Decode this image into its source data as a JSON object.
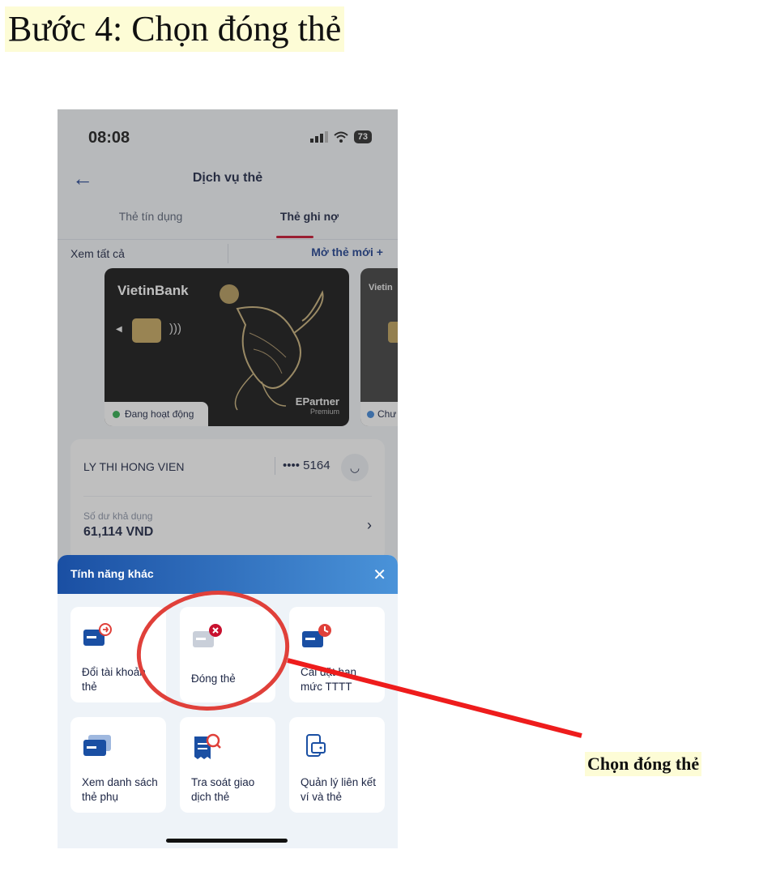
{
  "doc": {
    "title": "Bước 4: Chọn đóng thẻ",
    "note": "Chọn đóng thẻ"
  },
  "status_bar": {
    "time": "08:08",
    "battery": "73"
  },
  "header": {
    "title": "Dịch vụ thẻ"
  },
  "tabs": [
    {
      "label": "Thẻ tín dụng",
      "active": false
    },
    {
      "label": "Thẻ ghi nợ",
      "active": true
    }
  ],
  "filter": {
    "view_all": "Xem tất cả",
    "open_new": "Mở thẻ mới +"
  },
  "card": {
    "bank": "VietinBank",
    "status": "Đang hoạt động",
    "brand": "EPartner",
    "tier": "Premium"
  },
  "card2": {
    "bank": "Vietin",
    "status": "Chư"
  },
  "account": {
    "holder": "LY THI HONG VIEN",
    "masked_number": "•••• 5164",
    "balance_label": "Số dư khả dụng",
    "balance_value": "61,114 VND"
  },
  "sheet": {
    "title": "Tính năng khác",
    "tiles": [
      {
        "label": "Đổi tài khoản thẻ",
        "icon": "card-swap-icon"
      },
      {
        "label": "Đóng thẻ",
        "icon": "card-close-icon"
      },
      {
        "label": "Cài đặt hạn mức TTTT",
        "icon": "card-limit-icon"
      },
      {
        "label": "Xem danh sách thẻ phụ",
        "icon": "card-list-icon"
      },
      {
        "label": "Tra soát giao dịch thẻ",
        "icon": "receipt-search-icon"
      },
      {
        "label": "Quản lý liên kết ví và thẻ",
        "icon": "wallet-link-icon"
      }
    ]
  },
  "colors": {
    "accent": "#1d3f8f",
    "highlight": "#e0403a",
    "annotation_line": "#ee1c1c"
  }
}
